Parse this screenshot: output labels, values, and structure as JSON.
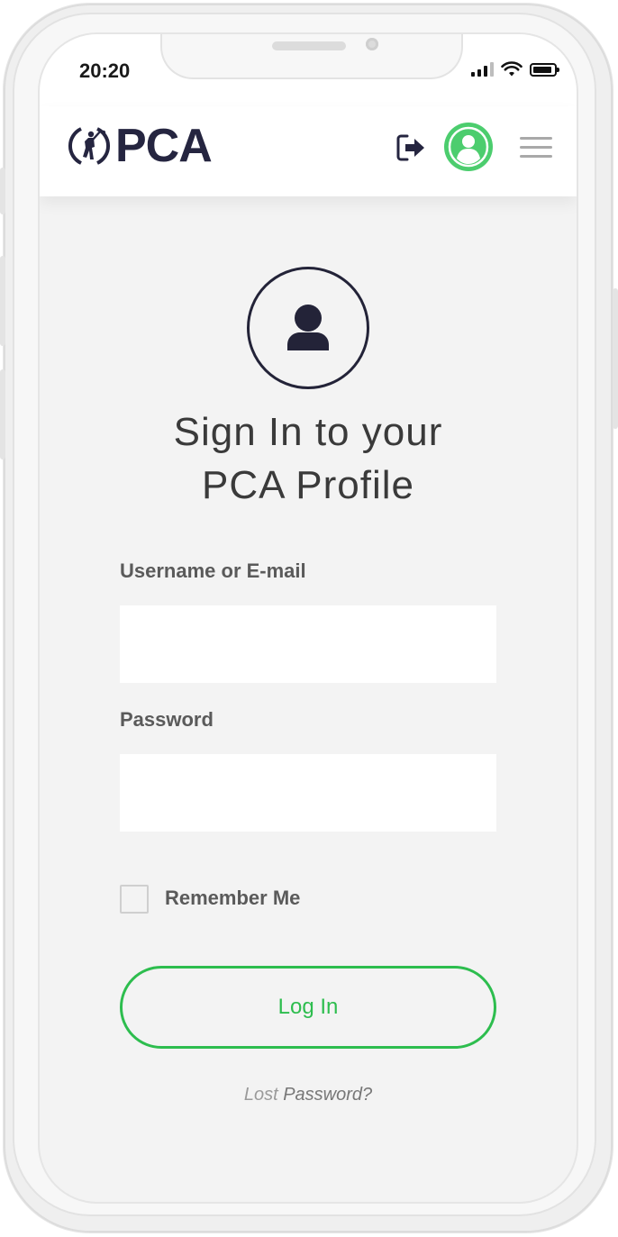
{
  "status_bar": {
    "time": "20:20",
    "signal_icon": "cellular-signal-icon",
    "wifi_icon": "wifi-icon",
    "battery_icon": "battery-icon"
  },
  "header": {
    "logo_text": "PCA",
    "logo_icon": "cricket-batsman-icon",
    "logout_icon": "logout-arrow-icon",
    "avatar_icon": "user-avatar-icon",
    "menu_icon": "hamburger-menu-icon"
  },
  "login": {
    "profile_icon": "user-silhouette-icon",
    "heading_line1": "Sign In to your",
    "heading_line2": "PCA Profile",
    "username_label": "Username or E-mail",
    "username_value": "",
    "password_label": "Password",
    "password_value": "",
    "remember_label": "Remember Me",
    "login_button": "Log In",
    "lost_password_prefix": "Lost ",
    "lost_password_link": "Password?"
  },
  "colors": {
    "brand_navy": "#252540",
    "accent_green": "#2dbd4e",
    "avatar_green": "#4ccd6e"
  }
}
